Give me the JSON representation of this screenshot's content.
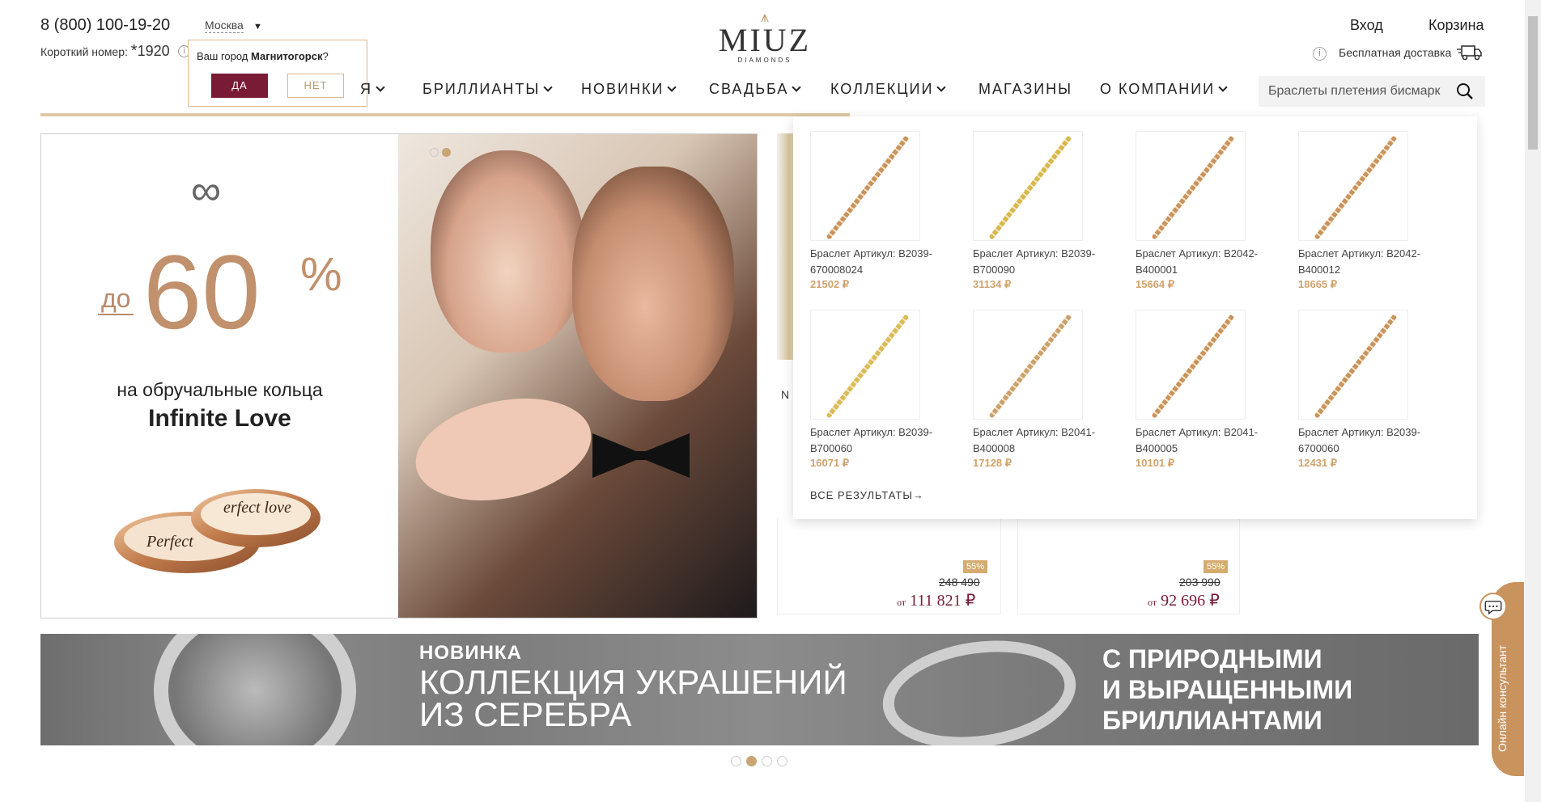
{
  "header": {
    "phone": "8 (800) 100-19-20",
    "short_label": "Короткий номер:",
    "short_star": "*",
    "short_number": "1920",
    "city": "Москва",
    "login": "Вход",
    "cart": "Корзина",
    "delivery": "Бесплатная доставка"
  },
  "city_popup": {
    "question_prefix": "Ваш город ",
    "city": "Магнитогорск",
    "question_suffix": "?",
    "yes": "ДА",
    "no": "НЕТ"
  },
  "logo": {
    "name": "MIUZ",
    "sub": "DIAMONDS"
  },
  "nav": {
    "items": [
      {
        "label": "Я"
      },
      {
        "label": "БРИЛЛИАНТЫ"
      },
      {
        "label": "НОВИНКИ"
      },
      {
        "label": "СВАДЬБА"
      },
      {
        "label": "КОЛЛЕКЦИИ"
      },
      {
        "label": "МАГАЗИНЫ"
      },
      {
        "label": "О КОМПАНИИ"
      }
    ]
  },
  "search": {
    "value": "Браслеты плетения бисмарк"
  },
  "hero": {
    "do": "до",
    "percent_value": "60",
    "percent_sign": "%",
    "line1": "на обручальные кольца",
    "line2": "Infinite Love",
    "ring_text1": "Perfect",
    "ring_text2": "erfect love"
  },
  "products": {
    "n_label": "N",
    "p1": {
      "badge": "55%",
      "old": "248 490",
      "price_prefix": "от",
      "price": "111 821 ₽"
    },
    "p2": {
      "badge": "55%",
      "old": "203 990",
      "price_prefix": "от",
      "price": "92 696 ₽"
    }
  },
  "dropdown": {
    "items": [
      {
        "title": "Браслет Артикул: B2039-670008024",
        "price": "21502 ₽",
        "color": "#c9935e"
      },
      {
        "title": "Браслет Артикул: B2039-B700090",
        "price": "31134 ₽",
        "color": "#d6b94a"
      },
      {
        "title": "Браслет Артикул: B2042-B400001",
        "price": "15664 ₽",
        "color": "#c9935e"
      },
      {
        "title": "Браслет Артикул: B2042-B400012",
        "price": "18665 ₽",
        "color": "#c9935e"
      },
      {
        "title": "Браслет Артикул: B2039-B700060",
        "price": "16071 ₽",
        "color": "#d9bc55"
      },
      {
        "title": "Браслет Артикул: B2041-B400008",
        "price": "17128 ₽",
        "color": "#c9a06e"
      },
      {
        "title": "Браслет Артикул: B2041-B400005",
        "price": "10101 ₽",
        "color": "#c9935e"
      },
      {
        "title": "Браслет Артикул: B2039-6700060",
        "price": "12431 ₽",
        "color": "#c9935e"
      }
    ],
    "all_results": "ВСЕ РЕЗУЛЬТАТЫ→"
  },
  "banner": {
    "new": "НОВИНКА",
    "coll1": "КОЛЛЕКЦИЯ УКРАШЕНИЙ",
    "coll2": "ИЗ СЕРЕБРА",
    "right1": "С ПРИРОДНЫМИ",
    "right2": "И ВЫРАЩЕННЫМИ",
    "right3": "БРИЛЛИАНТАМИ"
  },
  "consultant": {
    "label": "Онлайн консультант"
  },
  "colors": {
    "brand": "#7a1b36",
    "gold": "#c9935e"
  },
  "icons": [
    "info-icon",
    "truck-icon",
    "search-icon",
    "chat-icon",
    "chevron-down-icon"
  ]
}
